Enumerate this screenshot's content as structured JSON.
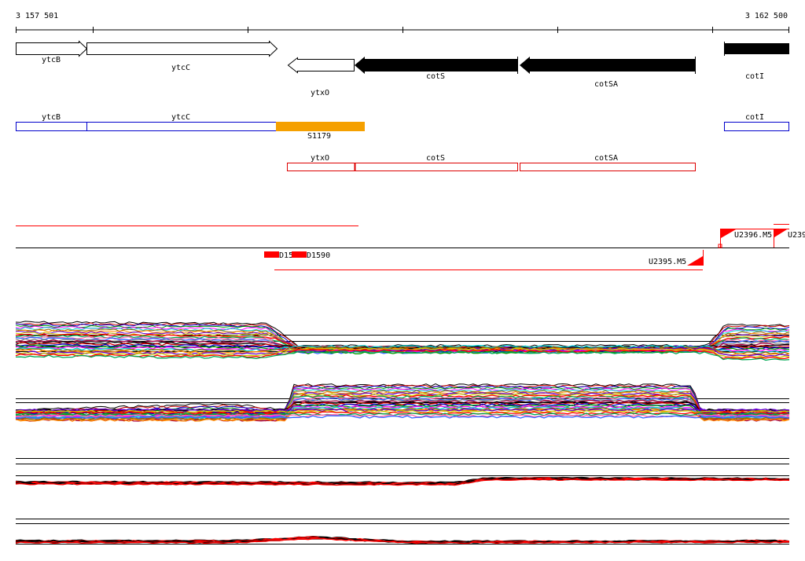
{
  "ruler": {
    "start_label": "3 157 501",
    "end_label": "3 162 500"
  },
  "colors": {
    "gene_fwd": "#ffffff",
    "gene_rev": "#000000",
    "cds_blue": "#0000cc",
    "cds_red": "#dd0000",
    "segment_orange": "#f5a000",
    "feature_red": "#ff0000"
  },
  "genes": [
    {
      "name": "ytcB",
      "strand": "+",
      "fill": "white"
    },
    {
      "name": "ytcC",
      "strand": "+",
      "fill": "white"
    },
    {
      "name": "ytxO",
      "strand": "-",
      "fill": "white"
    },
    {
      "name": "cotS",
      "strand": "-",
      "fill": "black"
    },
    {
      "name": "cotSA",
      "strand": "-",
      "fill": "black"
    },
    {
      "name": "cotI",
      "strand": "-",
      "fill": "black"
    }
  ],
  "blue_track": [
    {
      "name": "ytcB"
    },
    {
      "name": "ytcC"
    },
    {
      "name": "cotI"
    }
  ],
  "segment": {
    "name": "S1179"
  },
  "red_track": [
    {
      "name": "ytxO"
    },
    {
      "name": "cotS"
    },
    {
      "name": "cotSA"
    }
  ],
  "features": [
    {
      "name": "D15"
    },
    {
      "name": "D1590"
    },
    {
      "name": "U2395.M5"
    },
    {
      "name": "U2396.M5"
    },
    {
      "name": "U239"
    }
  ]
}
